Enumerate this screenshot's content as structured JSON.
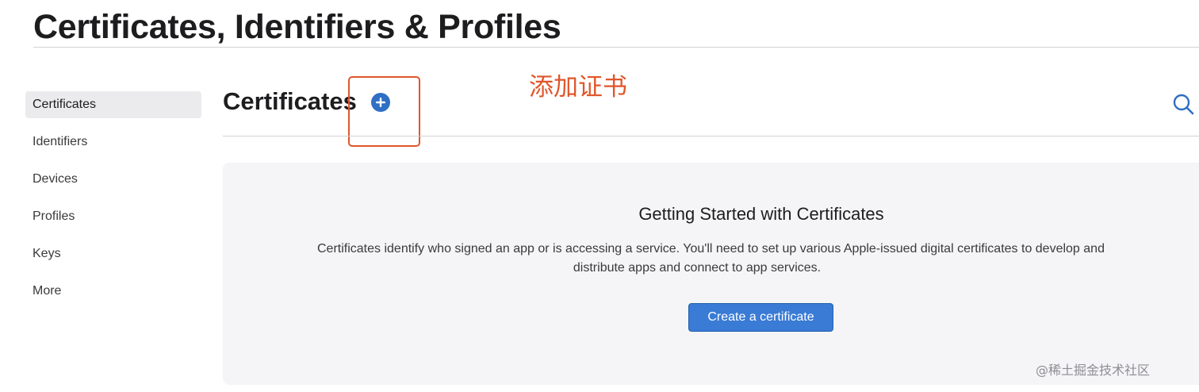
{
  "header": {
    "title": "Certificates, Identifiers & Profiles"
  },
  "sidebar": {
    "items": [
      {
        "label": "Certificates",
        "active": true
      },
      {
        "label": "Identifiers",
        "active": false
      },
      {
        "label": "Devices",
        "active": false
      },
      {
        "label": "Profiles",
        "active": false
      },
      {
        "label": "Keys",
        "active": false
      },
      {
        "label": "More",
        "active": false
      }
    ]
  },
  "main": {
    "section_title": "Certificates",
    "add_icon": "plus-circle-icon",
    "search_icon": "search-icon",
    "annotation": "添加证书",
    "panel": {
      "heading": "Getting Started with Certificates",
      "text_line1": "Certificates identify who signed an app or is accessing a service. You'll need to set up various Apple-issued digital certificates to develop and",
      "text_line2": "distribute apps and connect to app services.",
      "button_label": "Create a certificate"
    }
  },
  "watermark": "@稀土掘金技术社区",
  "colors": {
    "accent": "#2f6fc4",
    "button": "#3a7bd5",
    "annotation": "#e0562b",
    "panel_bg": "#f5f5f7",
    "sidebar_active_bg": "#ebebed"
  }
}
